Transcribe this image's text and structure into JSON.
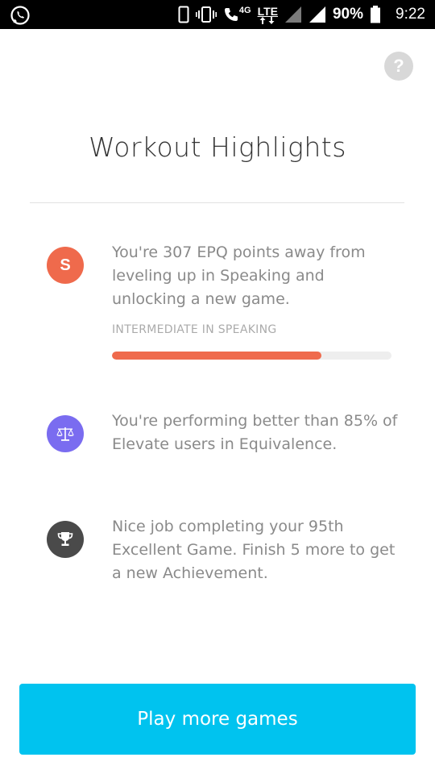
{
  "status_bar": {
    "network_type": "4G",
    "network_label": "LTE",
    "battery_percent": "90%",
    "time": "9:22",
    "icons": [
      "whatsapp-icon",
      "phone-icon",
      "vibrate-icon",
      "call-icon",
      "signal-icon",
      "signal-icon",
      "battery-icon"
    ]
  },
  "help": {
    "label": "?"
  },
  "title": "Workout Highlights",
  "highlights": [
    {
      "icon_letter": "S",
      "icon": "speaking-badge-icon",
      "text": "You're 307 EPQ points away from leveling up in Speaking and unlocking a new game.",
      "progress_label": "INTERMEDIATE IN SPEAKING",
      "progress": 0.75,
      "color": "#ef6a4c"
    },
    {
      "icon": "scale-icon",
      "text": "You're performing better than 85% of Elevate users in Equivalence.",
      "color": "#7a6cf0"
    },
    {
      "icon": "trophy-icon",
      "text": "Nice job completing your 95th Excellent Game. Finish 5 more to get a new Achievement.",
      "color": "#4a4a4a"
    }
  ],
  "play_button": {
    "label": "Play more games",
    "color": "#00c3ef"
  }
}
